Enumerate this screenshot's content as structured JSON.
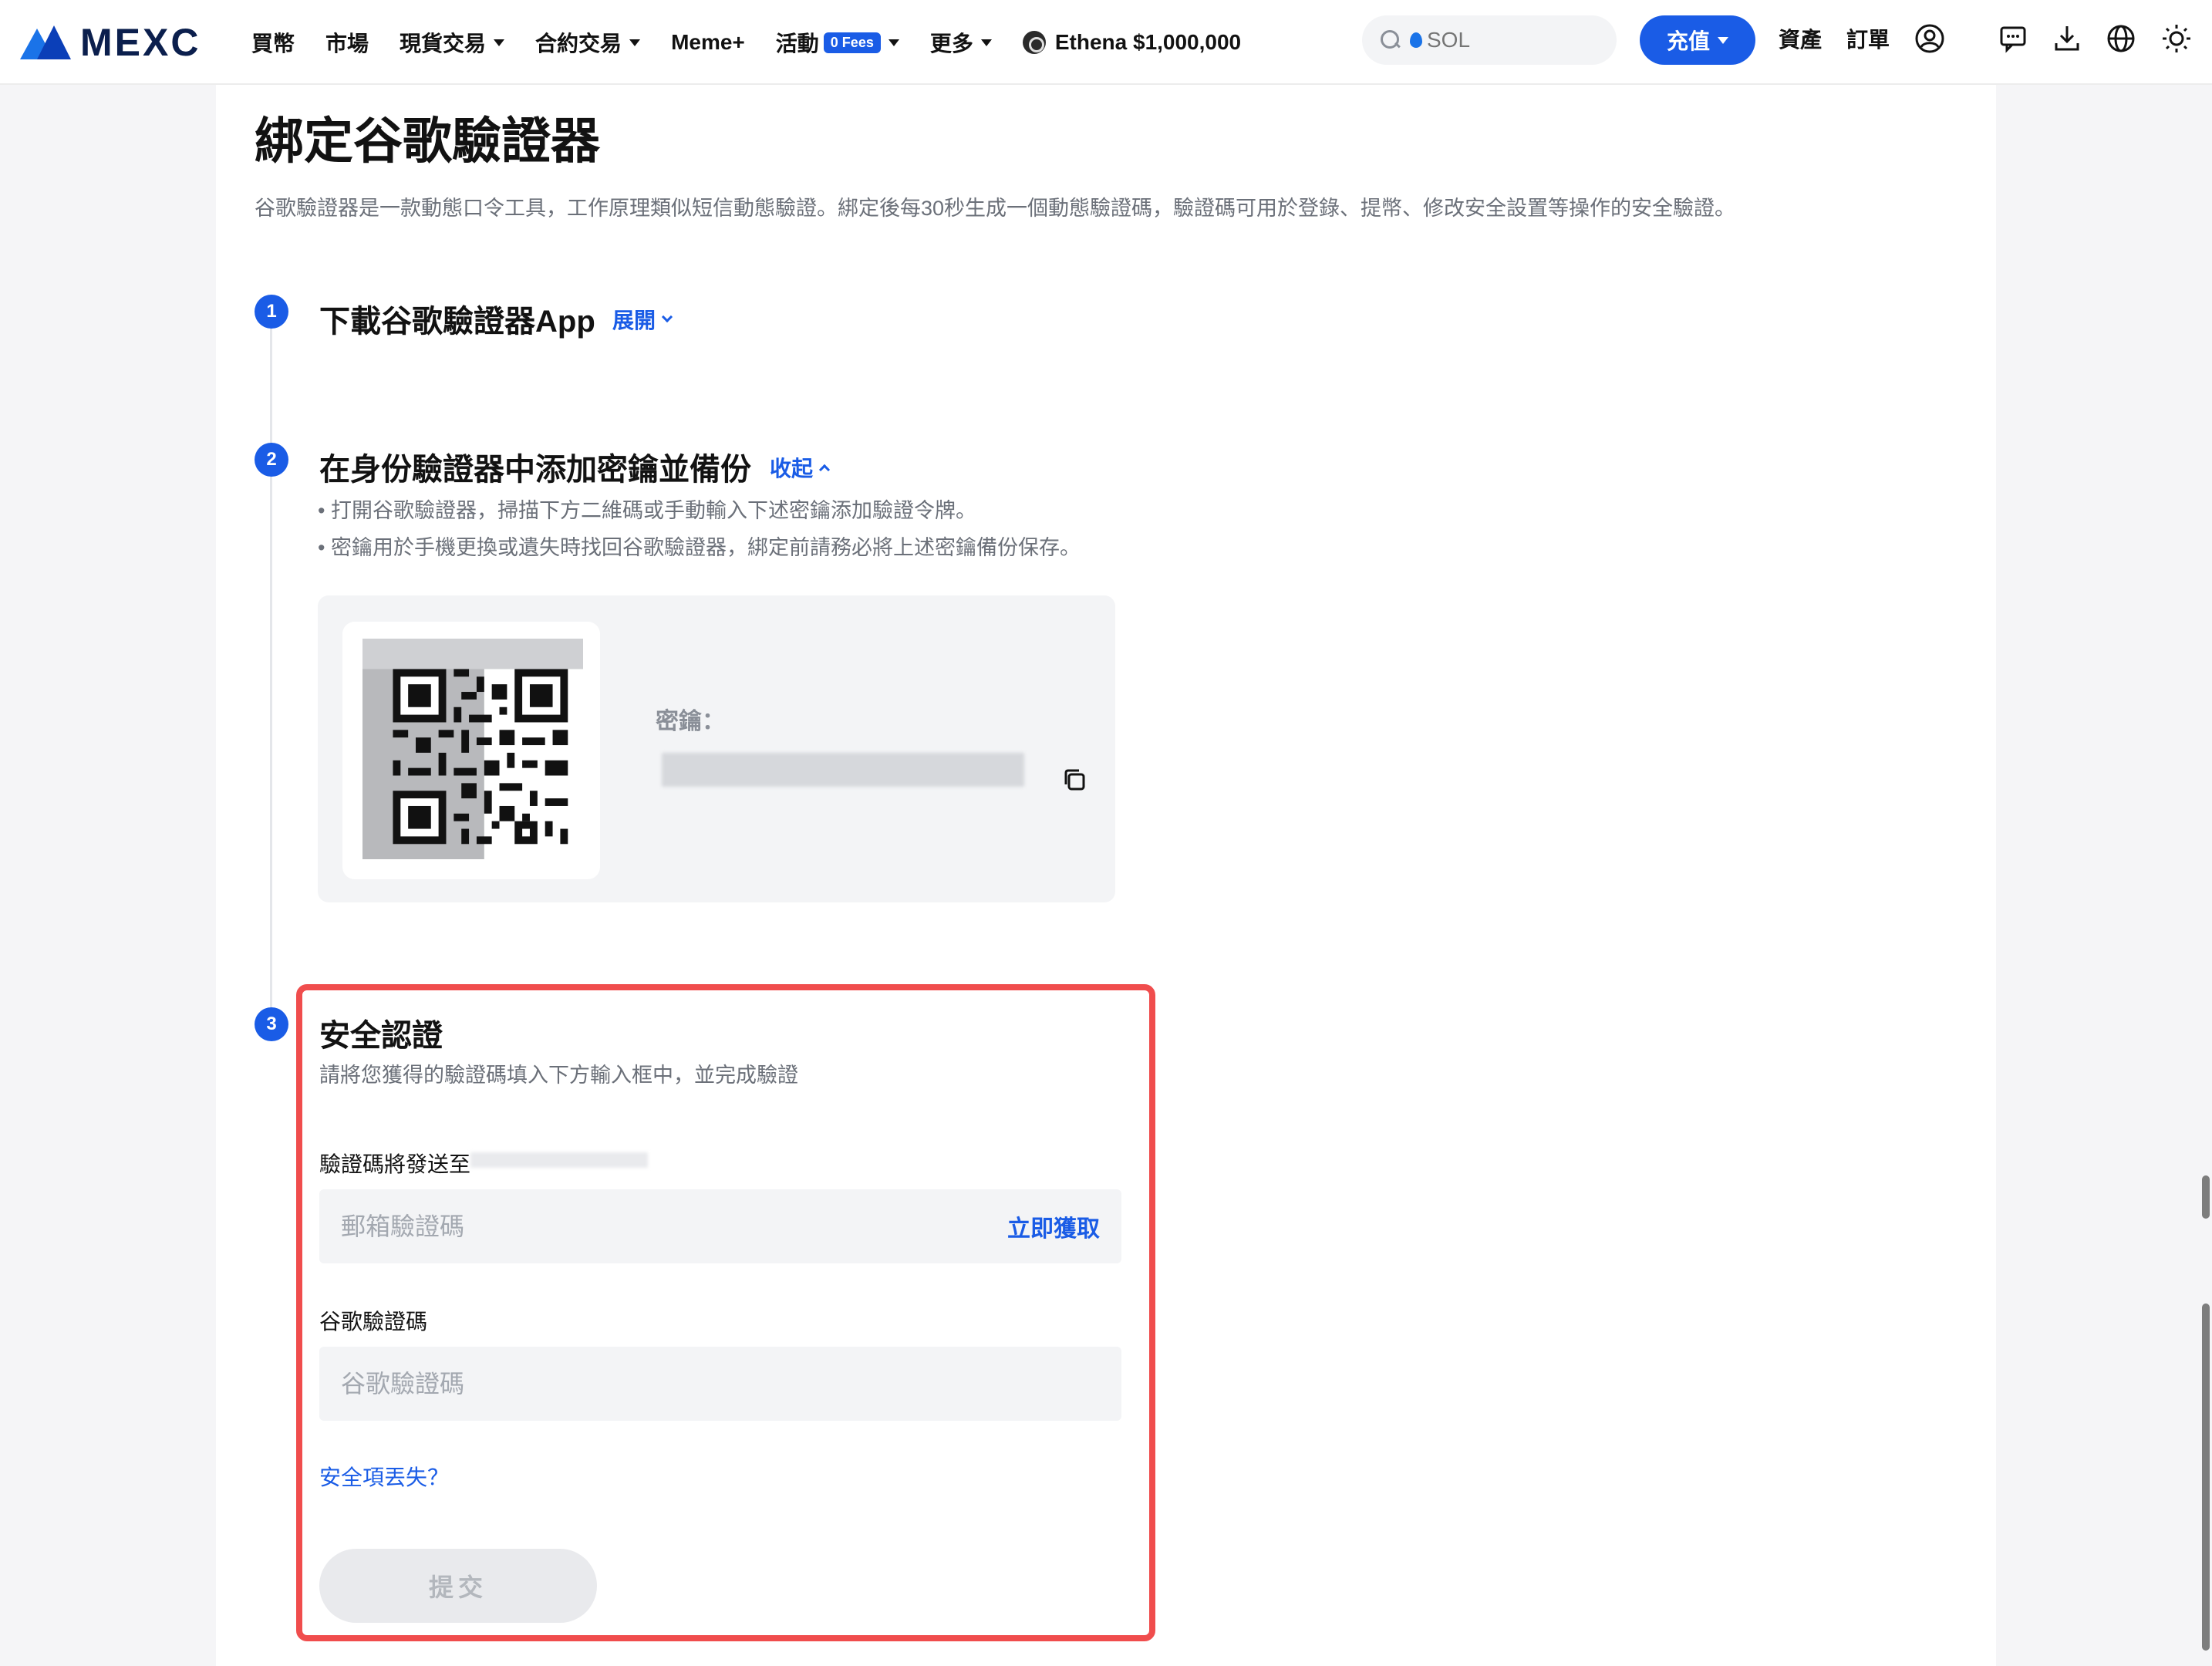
{
  "header": {
    "logo_text": "MEXC",
    "nav": [
      {
        "label": "買幣",
        "dropdown": false
      },
      {
        "label": "市場",
        "dropdown": false
      },
      {
        "label": "現貨交易",
        "dropdown": true
      },
      {
        "label": "合約交易",
        "dropdown": true
      },
      {
        "label": "Meme+",
        "dropdown": false
      },
      {
        "label": "活動",
        "dropdown": true,
        "badge": "0 Fees"
      },
      {
        "label": "更多",
        "dropdown": true
      },
      {
        "label": "Ethena $1,000,000",
        "dropdown": false
      }
    ],
    "search_placeholder": "SOL",
    "deposit_label": "充值",
    "assets_label": "資產",
    "orders_label": "訂單",
    "icons": [
      "user-icon",
      "chat-icon",
      "download-icon",
      "globe-icon",
      "sun-icon"
    ]
  },
  "page": {
    "title": "綁定谷歌驗證器",
    "description": "谷歌驗證器是一款動態口令工具，工作原理類似短信動態驗證。綁定後每30秒生成一個動態驗證碼，驗證碼可用於登錄、提幣、修改安全設置等操作的安全驗證。"
  },
  "steps": [
    {
      "number": "1",
      "title": "下載谷歌驗證器App",
      "toggle": "展開"
    },
    {
      "number": "2",
      "title": "在身份驗證器中添加密鑰並備份",
      "toggle": "收起",
      "bullets": [
        "• 打開谷歌驗證器，掃描下方二維碼或手動輸入下述密鑰添加驗證令牌。",
        "• 密鑰用於手機更換或遺失時找回谷歌驗證器，綁定前請務必將上述密鑰備份保存。"
      ],
      "secret_label": "密鑰：",
      "secret_value": "••••••••••••••••••••••••••••••••"
    },
    {
      "number": "3",
      "title": "安全認證",
      "subtitle": "請將您獲得的驗證碼填入下方輸入框中，並完成驗證",
      "email_label": "驗證碼將發送至",
      "email_placeholder": "郵箱驗證碼",
      "get_code_label": "立即獲取",
      "google_label": "谷歌驗證碼",
      "google_placeholder": "谷歌驗證碼",
      "lost_link": "安全項丟失？",
      "submit_label": "提交"
    }
  ],
  "colors": {
    "accent": "#1a5ce6",
    "highlight_border": "#f04d4d",
    "muted_text": "#6b7079"
  }
}
